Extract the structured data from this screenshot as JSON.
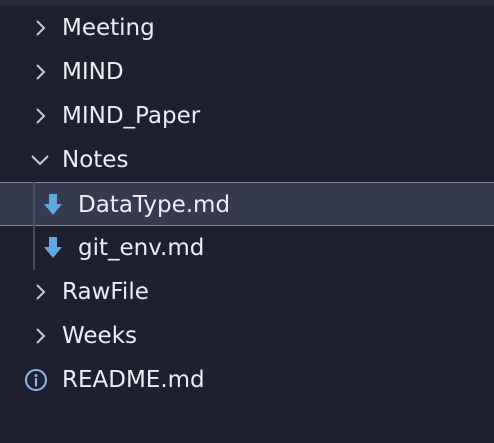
{
  "explorer": {
    "items": [
      {
        "label": "Meeting",
        "icon": "chevron-right-icon"
      },
      {
        "label": "MIND",
        "icon": "chevron-right-icon"
      },
      {
        "label": "MIND_Paper",
        "icon": "chevron-right-icon"
      },
      {
        "label": "Notes",
        "icon": "chevron-down-icon",
        "expanded": true
      },
      {
        "label": "DataType.md",
        "icon": "markdown-download-icon",
        "selected": true
      },
      {
        "label": "git_env.md",
        "icon": "markdown-download-icon"
      },
      {
        "label": "RawFile",
        "icon": "chevron-right-icon"
      },
      {
        "label": "Weeks",
        "icon": "chevron-right-icon"
      },
      {
        "label": "README.md",
        "icon": "info-icon"
      }
    ]
  },
  "colors": {
    "background": "#1e2030",
    "text": "#eceef5",
    "selection": "#363a4f",
    "selection_border": "#7f849c",
    "markdown_icon": "#5ea8e6",
    "info_icon": "#8ab4e8"
  }
}
